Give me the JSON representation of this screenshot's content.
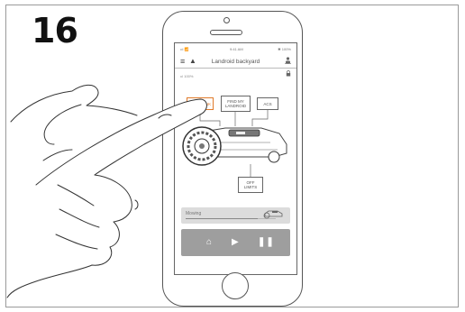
{
  "step_number": "16",
  "phone": {
    "status_bar": {
      "signal": "•ıl 📶",
      "time": "9:41 AM",
      "battery": "✱ 100%"
    },
    "app": {
      "title": "Landroid backyard",
      "signal_text": "ııl 100%",
      "icons": {
        "menu": "menu-icon",
        "warning": "warning-icon",
        "user": "user-icon",
        "lock": "lock-icon"
      },
      "callouts": {
        "radiolink": "RADIOLINK",
        "find_my_landroid": [
          "FIND MY",
          "LANDROID"
        ],
        "acs": "ACS",
        "off_limits": [
          "OFF",
          "LIMITS"
        ]
      },
      "status": {
        "label": "Mowing",
        "progress": 0.8
      },
      "controls": {
        "home": "⌂",
        "play": "▶",
        "pause": "❚❚"
      }
    }
  },
  "colors": {
    "highlight": "#e07a2a",
    "control_bar": "#9e9e9e",
    "status_card": "#dcdcdc"
  }
}
